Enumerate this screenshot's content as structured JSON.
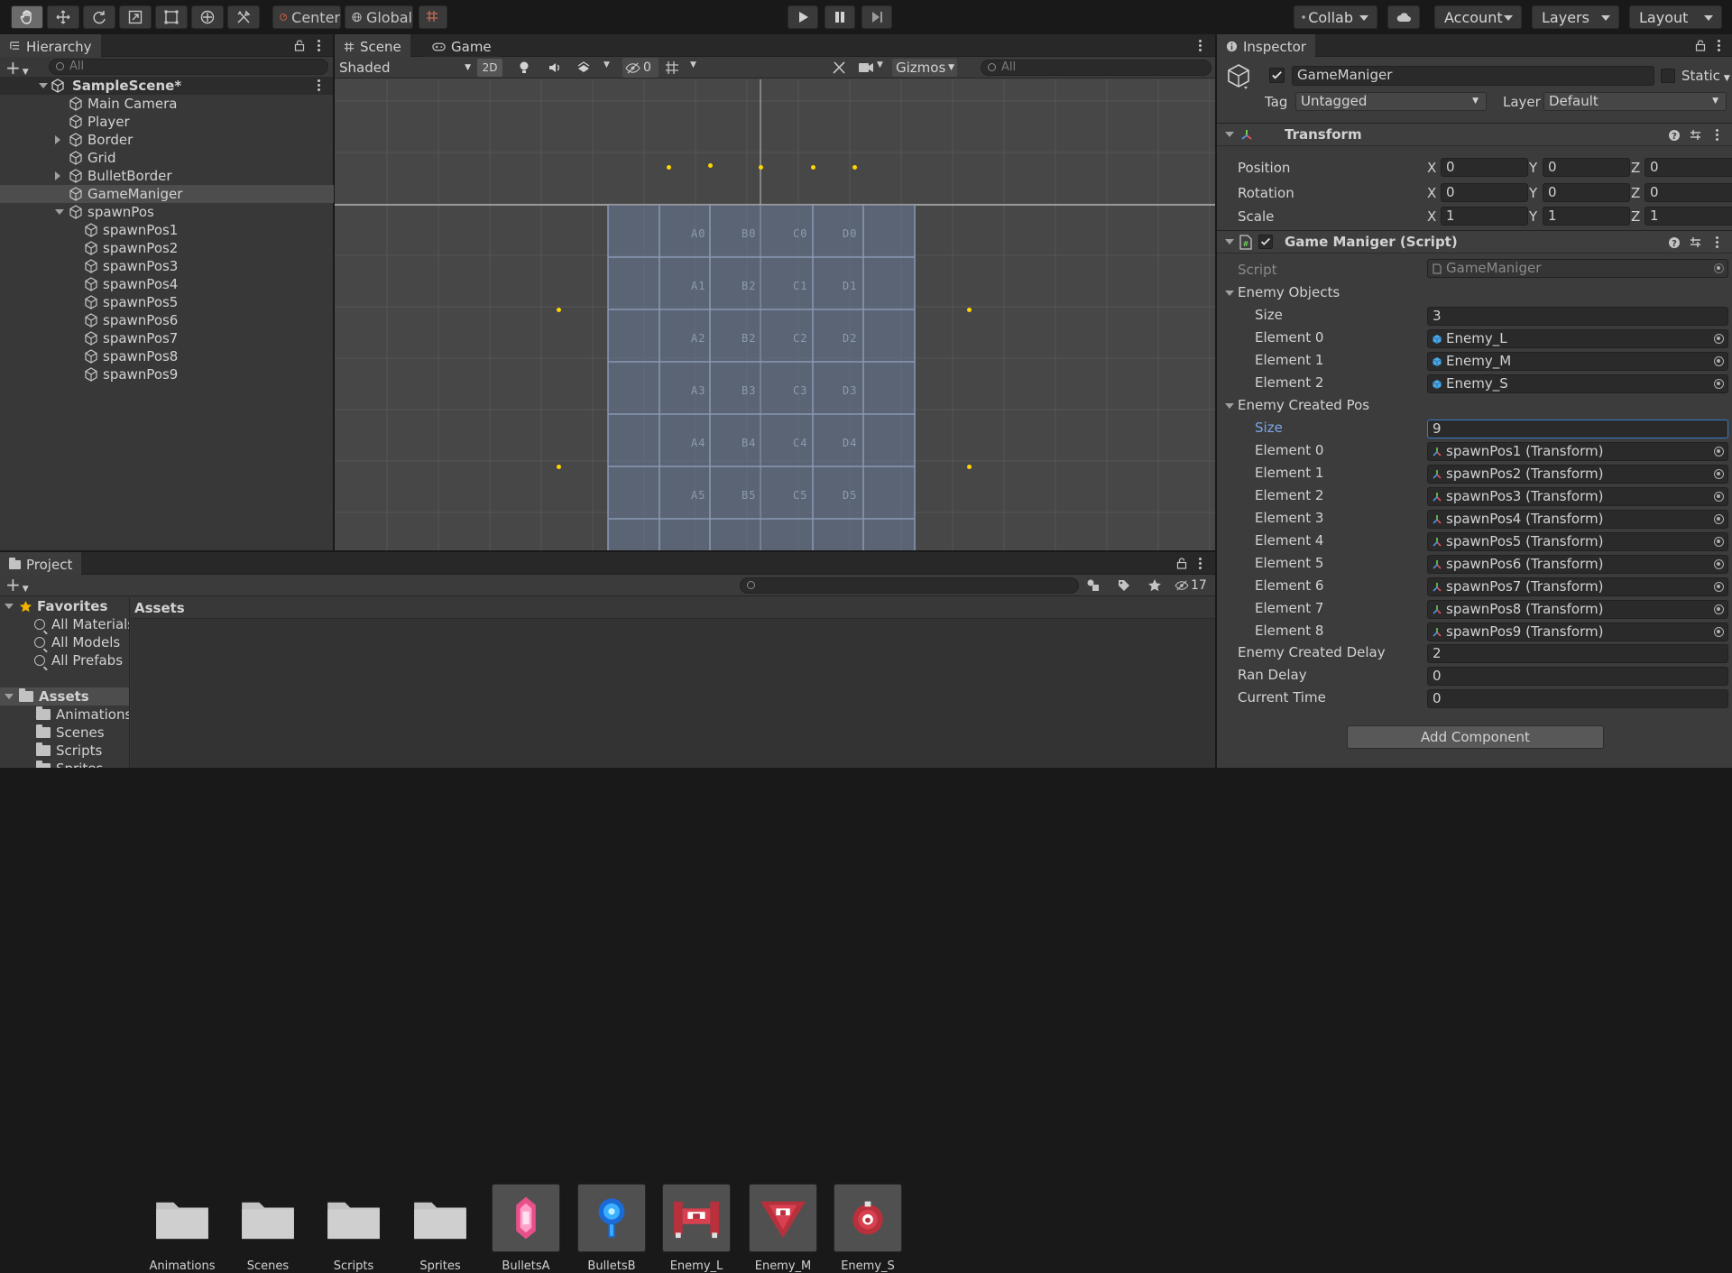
{
  "toolbar": {
    "pivot_label": "Center",
    "space_label": "Global",
    "collab_label": "Collab",
    "account_label": "Account",
    "layers_label": "Layers",
    "layout_label": "Layout"
  },
  "hierarchy": {
    "tab_label": "Hierarchy",
    "search_placeholder": "All",
    "scene_name": "SampleScene*",
    "items": [
      {
        "label": "Main Camera"
      },
      {
        "label": "Player"
      },
      {
        "label": "Border"
      },
      {
        "label": "Grid"
      },
      {
        "label": "BulletBorder"
      },
      {
        "label": "GameManiger"
      },
      {
        "label": "spawnPos"
      },
      {
        "label": "spawnPos1"
      },
      {
        "label": "spawnPos2"
      },
      {
        "label": "spawnPos3"
      },
      {
        "label": "spawnPos4"
      },
      {
        "label": "spawnPos5"
      },
      {
        "label": "spawnPos6"
      },
      {
        "label": "spawnPos7"
      },
      {
        "label": "spawnPos8"
      },
      {
        "label": "spawnPos9"
      }
    ]
  },
  "scene": {
    "tab_scene": "Scene",
    "tab_game": "Game",
    "shading_mode": "Shaded",
    "mode_2d": "2D",
    "hidden_count": "0",
    "gizmos_label": "Gizmos",
    "search_placeholder": "All",
    "grid_labels": [
      [
        "A0",
        "B0",
        "C0",
        "D0"
      ],
      [
        "A1",
        "B2",
        "C1",
        "D1"
      ],
      [
        "A2",
        "B2",
        "C2",
        "D2"
      ],
      [
        "A3",
        "B3",
        "C3",
        "D3"
      ],
      [
        "A4",
        "B4",
        "C4",
        "D4"
      ],
      [
        "A5",
        "B5",
        "C5",
        "D5"
      ]
    ]
  },
  "project": {
    "tab_label": "Project",
    "hidden_count": "17",
    "favorites_label": "Favorites",
    "favorites": [
      "All Materials",
      "All Models",
      "All Prefabs"
    ],
    "assets_label": "Assets",
    "asset_folders": [
      "Animations",
      "Scenes",
      "Scripts",
      "Sprites"
    ],
    "breadcrumb": "Assets",
    "assets": [
      {
        "label": "Animations",
        "kind": "folder"
      },
      {
        "label": "Scenes",
        "kind": "folder"
      },
      {
        "label": "Scripts",
        "kind": "folder"
      },
      {
        "label": "Sprites",
        "kind": "folder"
      },
      {
        "label": "BulletsA",
        "kind": "sprite"
      },
      {
        "label": "BulletsB",
        "kind": "sprite"
      },
      {
        "label": "Enemy_L",
        "kind": "sprite"
      },
      {
        "label": "Enemy_M",
        "kind": "sprite"
      },
      {
        "label": "Enemy_S",
        "kind": "sprite"
      }
    ]
  },
  "inspector": {
    "tab_label": "Inspector",
    "object_name": "GameManiger",
    "static_label": "Static",
    "tag_label": "Tag",
    "tag_value": "Untagged",
    "layer_label": "Layer",
    "layer_value": "Default",
    "transform": {
      "title": "Transform",
      "position_label": "Position",
      "rotation_label": "Rotation",
      "scale_label": "Scale",
      "axis_x": "X",
      "axis_y": "Y",
      "axis_z": "Z",
      "position": [
        "0",
        "0",
        "0"
      ],
      "rotation": [
        "0",
        "0",
        "0"
      ],
      "scale": [
        "1",
        "1",
        "1"
      ]
    },
    "script_component": {
      "title": "Game Maniger (Script)",
      "script_label": "Script",
      "script_value": "GameManiger",
      "enemy_objects_label": "Enemy Objects",
      "size_label": "Size",
      "enemy_objects_size": "3",
      "enemy_objects": [
        {
          "label": "Element 0",
          "value": "Enemy_L"
        },
        {
          "label": "Element 1",
          "value": "Enemy_M"
        },
        {
          "label": "Element 2",
          "value": "Enemy_S"
        }
      ],
      "enemy_created_pos_label": "Enemy Created Pos",
      "enemy_created_pos_size": "9",
      "enemy_created_pos": [
        {
          "label": "Element 0",
          "value": "spawnPos1 (Transform)"
        },
        {
          "label": "Element 1",
          "value": "spawnPos2 (Transform)"
        },
        {
          "label": "Element 2",
          "value": "spawnPos3 (Transform)"
        },
        {
          "label": "Element 3",
          "value": "spawnPos4 (Transform)"
        },
        {
          "label": "Element 4",
          "value": "spawnPos5 (Transform)"
        },
        {
          "label": "Element 5",
          "value": "spawnPos6 (Transform)"
        },
        {
          "label": "Element 6",
          "value": "spawnPos7 (Transform)"
        },
        {
          "label": "Element 7",
          "value": "spawnPos8 (Transform)"
        },
        {
          "label": "Element 8",
          "value": "spawnPos9 (Transform)"
        }
      ],
      "enemy_created_delay_label": "Enemy Created Delay",
      "enemy_created_delay": "2",
      "ran_delay_label": "Ran Delay",
      "ran_delay": "0",
      "current_time_label": "Current Time",
      "current_time": "0"
    },
    "add_component_label": "Add Component"
  }
}
